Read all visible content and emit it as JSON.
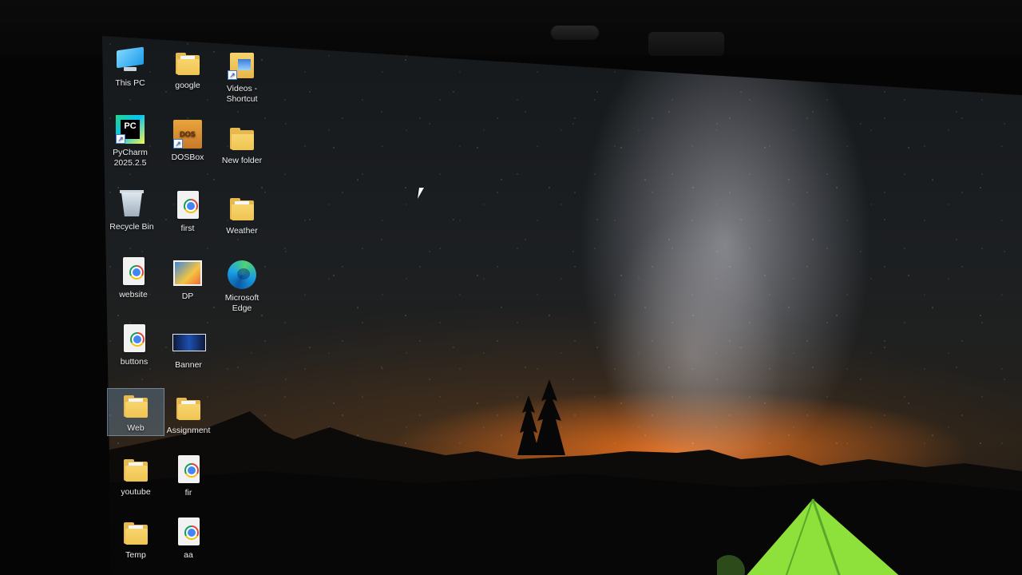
{
  "desktop": {
    "icons": [
      {
        "label": "This PC",
        "icon": "monitor-icon"
      },
      {
        "label": "google",
        "icon": "folder-icon"
      },
      {
        "label": "Videos - Shortcut",
        "icon": "video-folder-shortcut-icon"
      },
      {
        "label": "PyCharm 2025.2.5",
        "icon": "pycharm-icon"
      },
      {
        "label": "DOSBox",
        "icon": "dosbox-icon"
      },
      {
        "label": "New folder",
        "icon": "folder-icon"
      },
      {
        "label": "Recycle Bin",
        "icon": "recycle-bin-icon"
      },
      {
        "label": "first",
        "icon": "chrome-document-icon"
      },
      {
        "label": "Weather",
        "icon": "folder-icon"
      },
      {
        "label": "website",
        "icon": "chrome-document-icon"
      },
      {
        "label": "DP",
        "icon": "image-icon"
      },
      {
        "label": "Microsoft Edge",
        "icon": "edge-icon"
      },
      {
        "label": "buttons",
        "icon": "chrome-document-icon"
      },
      {
        "label": "Banner",
        "icon": "image-icon"
      },
      {
        "label": "Web",
        "icon": "folder-icon",
        "selected": true
      },
      {
        "label": "Assignment",
        "icon": "folder-icon"
      },
      {
        "label": "youtube",
        "icon": "folder-icon"
      },
      {
        "label": "fir",
        "icon": "chrome-document-icon"
      },
      {
        "label": "Temp",
        "icon": "folder-icon"
      },
      {
        "label": "aa",
        "icon": "chrome-document-icon"
      }
    ]
  },
  "colors": {
    "selection": "#8cbeeb",
    "folder": "#efc552",
    "sunset": "#ff7a1e",
    "tent": "#8ee03a"
  }
}
